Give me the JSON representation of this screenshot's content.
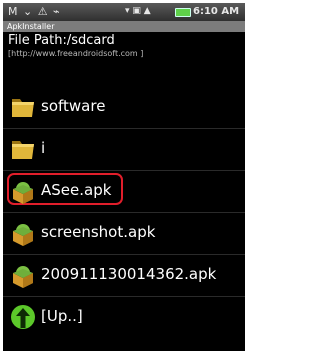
{
  "status_bar": {
    "left_glyphs": "M ⌄ ⚠ ⌁",
    "right_glyphs": "▾ ▣ ▲",
    "time": "6:10 AM"
  },
  "app_title": "ApkInstaller",
  "file_path": "File Path:/sdcard",
  "url": "[http://www.freeandroidsoft.com ]",
  "items": [
    {
      "label": "software",
      "icon": "folder-icon"
    },
    {
      "label": "i",
      "icon": "folder-icon"
    },
    {
      "label": "ASee.apk",
      "icon": "apk-package-icon",
      "highlighted": true
    },
    {
      "label": "screenshot.apk",
      "icon": "apk-package-icon"
    },
    {
      "label": "200911130014362.apk",
      "icon": "apk-package-icon"
    },
    {
      "label": "[Up..]",
      "icon": "up-arrow-icon"
    }
  ],
  "colors": {
    "highlight_border": "#e11e2b",
    "folder": "#e0b63a",
    "apk_box": "#d69a2c",
    "android_green": "#7bc043",
    "up_arrow": "#5cc82a"
  }
}
